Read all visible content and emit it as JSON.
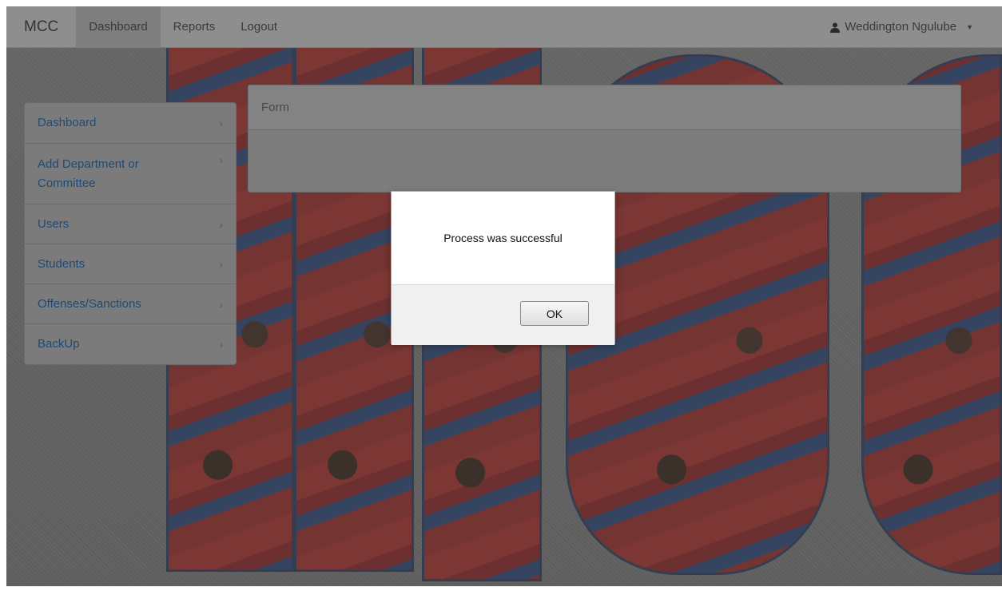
{
  "navbar": {
    "brand": "MCC",
    "links": [
      "Dashboard",
      "Reports",
      "Logout"
    ],
    "user": "Weddington Ngulube"
  },
  "sidebar": {
    "items": [
      {
        "label": "Dashboard"
      },
      {
        "label": "Add Department or Committee"
      },
      {
        "label": "Users"
      },
      {
        "label": "Students"
      },
      {
        "label": "Offenses/Sanctions"
      },
      {
        "label": "BackUp"
      }
    ]
  },
  "panel": {
    "title": "Form"
  },
  "dialog": {
    "message": "Process was successful",
    "ok_label": "OK"
  },
  "colors": {
    "link": "#1f4a75",
    "overlay": "#5a5a5a"
  }
}
